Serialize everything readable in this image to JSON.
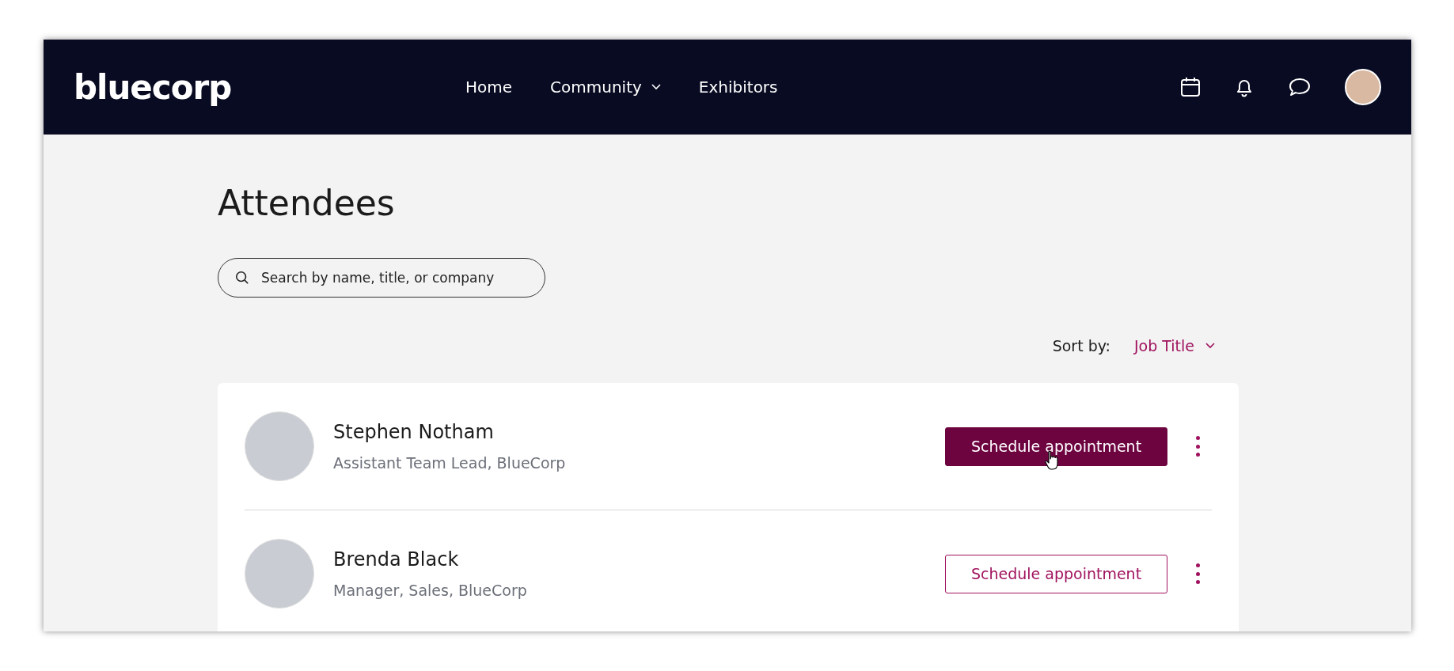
{
  "nav": {
    "logo": "bluecorp",
    "links": [
      {
        "label": "Home",
        "dropdown": false
      },
      {
        "label": "Community",
        "dropdown": true
      },
      {
        "label": "Exhibitors",
        "dropdown": false
      }
    ]
  },
  "page": {
    "title": "Attendees",
    "search": {
      "placeholder": "Search by name, title, or company"
    },
    "sort": {
      "label": "Sort by:",
      "value": "Job Title"
    }
  },
  "attendees": [
    {
      "name": "Stephen Notham",
      "title": "Assistant Team Lead, BlueCorp",
      "button": "Schedule appointment",
      "hovered": true
    },
    {
      "name": "Brenda Black",
      "title": "Manager, Sales, BlueCorp",
      "button": "Schedule appointment",
      "hovered": false
    }
  ]
}
